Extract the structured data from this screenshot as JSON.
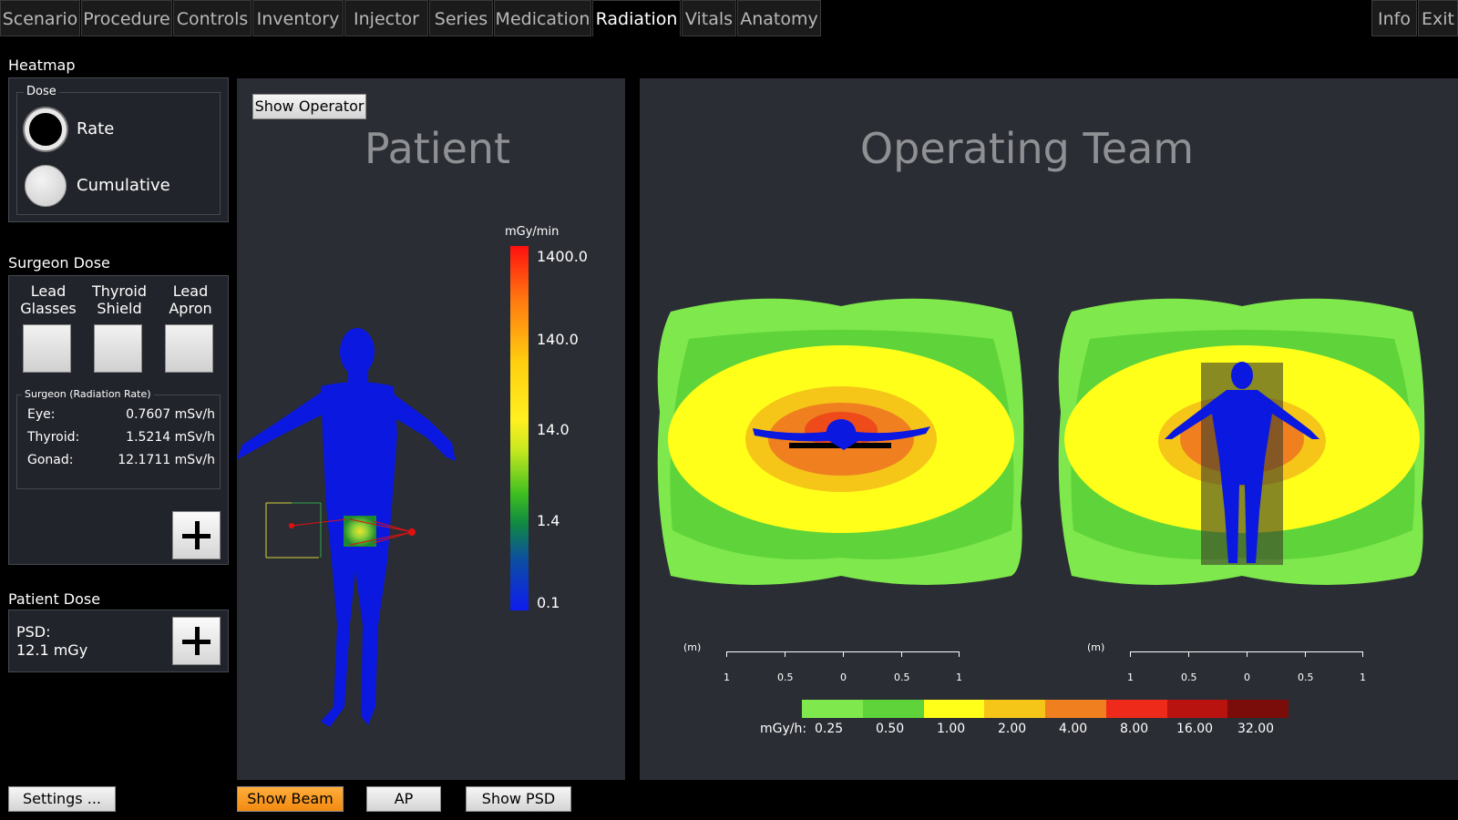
{
  "tabs": [
    "Scenario",
    "Procedure",
    "Controls",
    "Inventory",
    "Injector",
    "Series",
    "Medication",
    "Radiation",
    "Vitals",
    "Anatomy"
  ],
  "right_tabs": [
    "Info",
    "Exit"
  ],
  "active_tab": "Radiation",
  "heatmap": {
    "title": "Heatmap",
    "group_label": "Dose",
    "options": [
      "Rate",
      "Cumulative"
    ],
    "selected": "Rate"
  },
  "surgeon_dose": {
    "title": "Surgeon Dose",
    "protections": [
      {
        "line1": "Lead",
        "line2": "Glasses",
        "checked": false
      },
      {
        "line1": "Thyroid",
        "line2": "Shield",
        "checked": false
      },
      {
        "line1": "Lead",
        "line2": "Apron",
        "checked": false
      }
    ],
    "rate_group_label": "Surgeon (Radiation Rate)",
    "rates": [
      {
        "label": "Eye:",
        "value": "0.7607 mSv/h"
      },
      {
        "label": "Thyroid:",
        "value": "1.5214 mSv/h"
      },
      {
        "label": "Gonad:",
        "value": "12.1711 mSv/h"
      }
    ]
  },
  "patient_dose": {
    "title": "Patient Dose",
    "psd_label": "PSD:",
    "psd_value": "12.1 mGy"
  },
  "patient_view": {
    "show_operator_button": "Show Operator",
    "title": "Patient",
    "colorbar_unit": "mGy/min",
    "colorbar_ticks": [
      "1400.0",
      "140.0",
      "14.0",
      "1.4",
      "0.1"
    ]
  },
  "team_view": {
    "title": "Operating Team",
    "scale_unit": "(m)",
    "scale_ticks": [
      "1",
      "0.5",
      "0",
      "0.5",
      "1"
    ],
    "legend_unit": "mGy/h:",
    "legend_values": [
      "0.25",
      "0.50",
      "1.00",
      "2.00",
      "4.00",
      "8.00",
      "16.00",
      "32.00"
    ],
    "legend_colors": [
      "#7ee84d",
      "#5fd33a",
      "#ffff1a",
      "#f5c518",
      "#f07f1f",
      "#ee2a1a",
      "#b8130f",
      "#7a0c0a"
    ]
  },
  "bottom_buttons": {
    "settings": "Settings ...",
    "show_beam": "Show Beam",
    "ap": "AP",
    "show_psd": "Show PSD"
  },
  "colors": {
    "accent_orange": "#f5951f",
    "panel": "#22242b",
    "view": "#2b2d34"
  }
}
